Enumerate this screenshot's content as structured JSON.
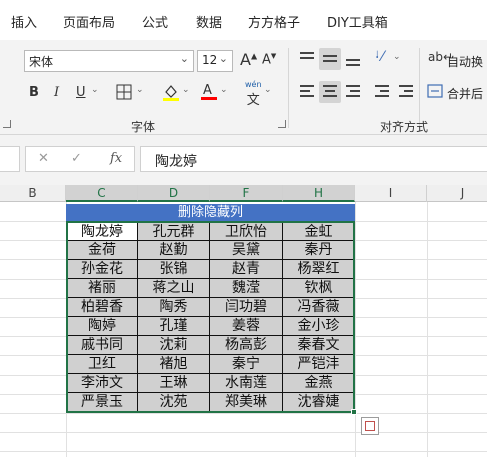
{
  "tabs": [
    "插入",
    "页面布局",
    "公式",
    "数据",
    "方方格子",
    "DIY工具箱"
  ],
  "ribbon": {
    "font_name": "宋体",
    "font_size": "12",
    "grow_font": "A",
    "shrink_font": "A",
    "bold": "B",
    "italic": "I",
    "underline": "U",
    "phonetic": "wén",
    "font_group_label": "字体",
    "wrap_text": "自动换",
    "merge_center": "合并后",
    "align_group_label": "对齐方式",
    "fill_color": "#ffff00",
    "font_color": "#ff0000"
  },
  "formula_bar": {
    "cancel": "✕",
    "confirm": "✓",
    "fx": "fx",
    "value": "陶龙婷"
  },
  "columns": [
    "B",
    "C",
    "D",
    "F",
    "H",
    "I",
    "J"
  ],
  "selected_columns": [
    "C",
    "D",
    "F",
    "H"
  ],
  "table": {
    "title": "删除隐藏列",
    "rows": [
      [
        "陶龙婷",
        "孔元群",
        "卫欣怡",
        "金虹"
      ],
      [
        "金荷",
        "赵勤",
        "吴黛",
        "秦丹"
      ],
      [
        "孙金花",
        "张锦",
        "赵青",
        "杨翠红"
      ],
      [
        "褚丽",
        "蒋之山",
        "魏滢",
        "钦枫"
      ],
      [
        "柏碧香",
        "陶秀",
        "闫功碧",
        "冯香薇"
      ],
      [
        "陶婷",
        "孔瑾",
        "姜蓉",
        "金小珍"
      ],
      [
        "戚书同",
        "沈莉",
        "杨高彭",
        "秦春文"
      ],
      [
        "卫红",
        "褚旭",
        "秦宁",
        "严铠沣"
      ],
      [
        "李沛文",
        "王琳",
        "水南莲",
        "金燕"
      ],
      [
        "严景玉",
        "沈苑",
        "郑美琳",
        "沈睿婕"
      ]
    ]
  },
  "colors": {
    "title_fill": "#4472c4",
    "cell_fill": "#d0d0d0",
    "selection": "#217346"
  }
}
